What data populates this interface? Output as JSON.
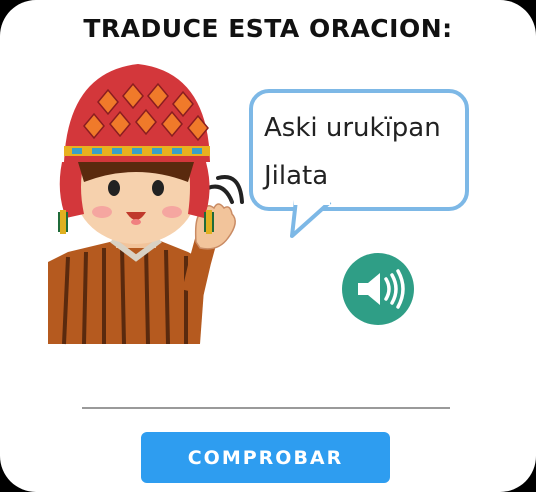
{
  "header": {
    "title": "TRADUCE ESTA ORACION:"
  },
  "speech_bubble": {
    "line1": "Aski urukïpan",
    "line2": "Jilata"
  },
  "audio_button": {
    "icon": "speaker-icon",
    "color": "#2f9e86"
  },
  "character": {
    "icon": "andean-character-illustration"
  },
  "actions": {
    "check_label": "COMPROBAR",
    "check_color": "#2e9df0"
  }
}
